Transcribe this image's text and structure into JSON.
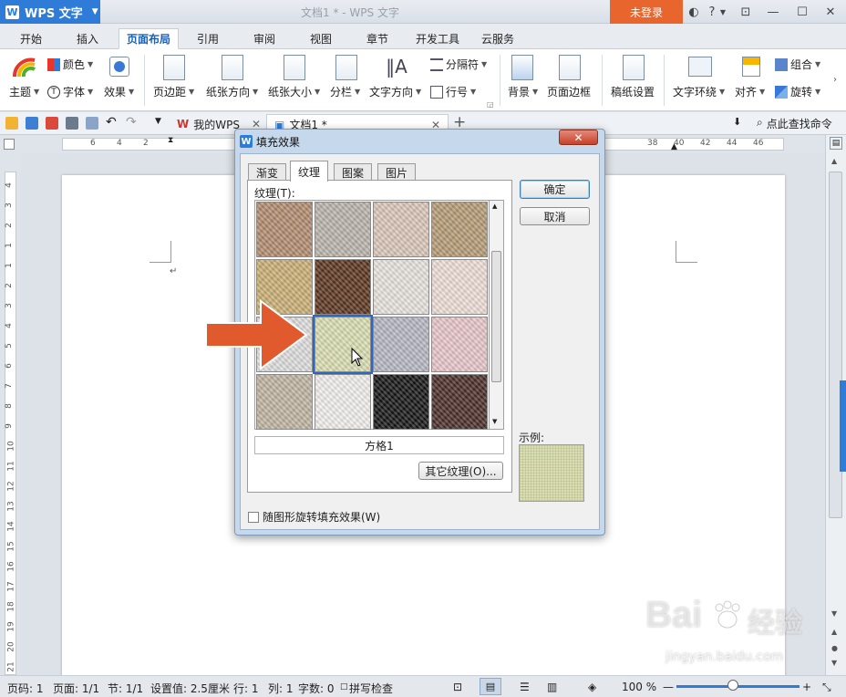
{
  "titlebar": {
    "app_name": "WPS 文字",
    "window_title": "文档1 * - WPS 文字",
    "login_label": "未登录"
  },
  "menu": {
    "tabs": [
      {
        "label": "开始"
      },
      {
        "label": "插入"
      },
      {
        "label": "页面布局"
      },
      {
        "label": "引用"
      },
      {
        "label": "审阅"
      },
      {
        "label": "视图"
      },
      {
        "label": "章节"
      },
      {
        "label": "开发工具"
      },
      {
        "label": "云服务"
      }
    ],
    "active_index": 2
  },
  "ribbon": {
    "theme": "主题",
    "color": "颜色",
    "font": "字体",
    "effect": "效果",
    "margins": "页边距",
    "orientation": "纸张方向",
    "size": "纸张大小",
    "columns": "分栏",
    "text_direction": "文字方向",
    "separator": "分隔符",
    "line_number": "行号",
    "background": "背景",
    "page_border": "页面边框",
    "manuscript": "稿纸设置",
    "wrap": "文字环绕",
    "align": "对齐",
    "group": "组合",
    "rotate": "旋转"
  },
  "quickbar": {
    "tabs": [
      {
        "label": "我的WPS"
      },
      {
        "label": "文档1 *"
      }
    ],
    "search_label": "点此查找命令"
  },
  "ruler": {
    "h_left": [
      "6",
      "4",
      "2"
    ],
    "h_right": [
      "38",
      "40",
      "42",
      "44",
      "46"
    ],
    "v_numbers": [
      "4",
      "3",
      "2",
      "1",
      "1",
      "2",
      "3",
      "4",
      "5",
      "6",
      "7",
      "8",
      "9",
      "10",
      "11",
      "12",
      "13",
      "14",
      "15",
      "16",
      "17",
      "18",
      "19",
      "20",
      "21"
    ]
  },
  "dialog": {
    "title": "填充效果",
    "tabs": [
      {
        "label": "渐变"
      },
      {
        "label": "纹理"
      },
      {
        "label": "图案"
      },
      {
        "label": "图片"
      }
    ],
    "active_tab": 1,
    "texture_label": "纹理(T):",
    "selected_texture_name": "方格1",
    "more_textures_button": "其它纹理(O)...",
    "ok_button": "确定",
    "cancel_button": "取消",
    "sample_label": "示例:",
    "rotate_checkbox_label": "随图形旋转填充效果(W)",
    "rotate_checked": false,
    "selected_index": 9,
    "textures": [
      {
        "name": "brown-marble",
        "color": "#b08a6e"
      },
      {
        "name": "granite",
        "color": "#b9b2aa"
      },
      {
        "name": "pink-paper",
        "color": "#d9c6b8"
      },
      {
        "name": "cork",
        "color": "#b39a75"
      },
      {
        "name": "sand",
        "color": "#c9ad74"
      },
      {
        "name": "leopard",
        "color": "#5a341e"
      },
      {
        "name": "newsprint",
        "color": "#e6e2dc"
      },
      {
        "name": "pink-wood",
        "color": "#eddcd5"
      },
      {
        "name": "white-grain",
        "color": "#dcdcdc"
      },
      {
        "name": "woven-mat",
        "color": "#d9ddb0"
      },
      {
        "name": "denim",
        "color": "#b6b6c2"
      },
      {
        "name": "pink-tissue",
        "color": "#e6c5c8"
      },
      {
        "name": "stationery",
        "color": "#bfb3a0"
      },
      {
        "name": "white-marble",
        "color": "#f1eeec"
      },
      {
        "name": "black-speckle",
        "color": "#151515"
      },
      {
        "name": "floral-brown",
        "color": "#4a2e28"
      }
    ]
  },
  "status": {
    "page": "页码: 1",
    "pages": "页面: 1/1",
    "section": "节: 1/1",
    "setting": "设置值: 2.5厘米",
    "row": "行: 1",
    "col": "列: 1",
    "words": "字数: 0",
    "spellcheck": "拼写检查",
    "zoom": "100 %",
    "zoom_fraction": 0.46
  },
  "watermark": {
    "brand": "Bai",
    "brand2": "经验",
    "url": "jingyan.baidu.com"
  },
  "colors": {
    "accent_blue": "#2f7bd8",
    "login_orange": "#e8652d",
    "arrow_orange": "#e15a2e"
  }
}
